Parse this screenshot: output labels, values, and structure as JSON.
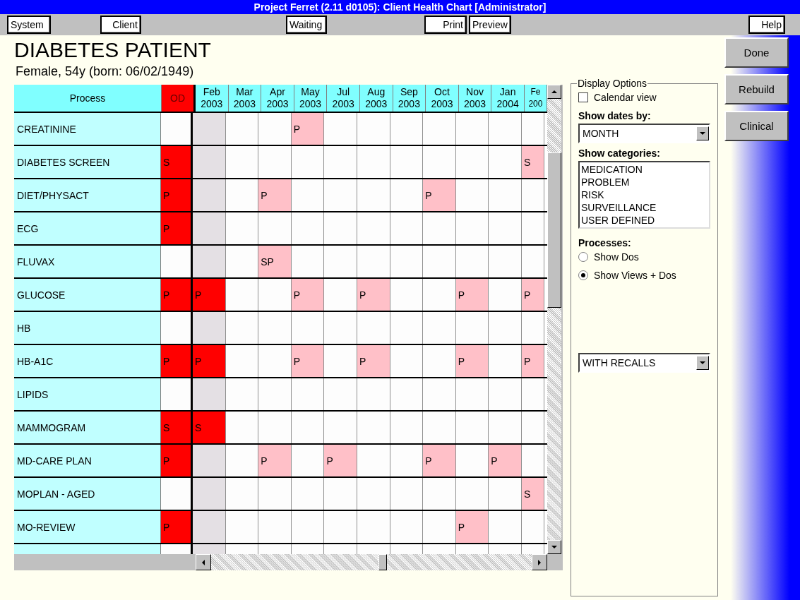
{
  "window": {
    "title": "Project Ferret (2.11 d0105): Client Health Chart [Administrator]"
  },
  "toolbar": [
    {
      "label": "System"
    },
    {
      "label": "Client"
    },
    {
      "label": "Waiting"
    },
    {
      "label": "Print"
    },
    {
      "label": "Preview"
    },
    {
      "label": "Help"
    }
  ],
  "patient": {
    "name": "DIABETES PATIENT",
    "details": "Female, 54y (born: 06/02/1949)"
  },
  "chart": {
    "process_heading": "Process",
    "od_heading": "OD",
    "months": [
      {
        "month": "Feb",
        "year": "2003"
      },
      {
        "month": "Mar",
        "year": "2003"
      },
      {
        "month": "Apr",
        "year": "2003"
      },
      {
        "month": "May",
        "year": "2003"
      },
      {
        "month": "Jul",
        "year": "2003"
      },
      {
        "month": "Aug",
        "year": "2003"
      },
      {
        "month": "Sep",
        "year": "2003"
      },
      {
        "month": "Oct",
        "year": "2003"
      },
      {
        "month": "Nov",
        "year": "2003"
      },
      {
        "month": "Jan",
        "year": "2004"
      },
      {
        "month": "Fe",
        "year": "200"
      }
    ],
    "rows": [
      {
        "name": "CREATININE",
        "od": {
          "kind": "empty"
        },
        "cells": [
          {
            "kind": "past"
          },
          {
            "kind": "empty"
          },
          {
            "kind": "empty"
          },
          {
            "kind": "pending",
            "mark": "P"
          },
          {
            "kind": "empty"
          },
          {
            "kind": "empty"
          },
          {
            "kind": "empty"
          },
          {
            "kind": "empty"
          },
          {
            "kind": "empty"
          },
          {
            "kind": "empty"
          },
          {
            "kind": "empty"
          }
        ]
      },
      {
        "name": "DIABETES SCREEN",
        "od": {
          "kind": "due",
          "mark": "S"
        },
        "cells": [
          {
            "kind": "past"
          },
          {
            "kind": "empty"
          },
          {
            "kind": "empty"
          },
          {
            "kind": "empty"
          },
          {
            "kind": "empty"
          },
          {
            "kind": "empty"
          },
          {
            "kind": "empty"
          },
          {
            "kind": "empty"
          },
          {
            "kind": "empty"
          },
          {
            "kind": "empty"
          },
          {
            "kind": "pending",
            "mark": "S"
          }
        ]
      },
      {
        "name": "DIET/PHYSACT",
        "od": {
          "kind": "due",
          "mark": "P"
        },
        "cells": [
          {
            "kind": "past"
          },
          {
            "kind": "empty"
          },
          {
            "kind": "pending",
            "mark": "P"
          },
          {
            "kind": "empty"
          },
          {
            "kind": "empty"
          },
          {
            "kind": "empty"
          },
          {
            "kind": "empty"
          },
          {
            "kind": "pending",
            "mark": "P"
          },
          {
            "kind": "empty"
          },
          {
            "kind": "empty"
          },
          {
            "kind": "empty"
          }
        ]
      },
      {
        "name": "ECG",
        "od": {
          "kind": "due",
          "mark": "P"
        },
        "cells": [
          {
            "kind": "past"
          },
          {
            "kind": "empty"
          },
          {
            "kind": "empty"
          },
          {
            "kind": "empty"
          },
          {
            "kind": "empty"
          },
          {
            "kind": "empty"
          },
          {
            "kind": "empty"
          },
          {
            "kind": "empty"
          },
          {
            "kind": "empty"
          },
          {
            "kind": "empty"
          },
          {
            "kind": "empty"
          }
        ]
      },
      {
        "name": "FLUVAX",
        "od": {
          "kind": "empty"
        },
        "cells": [
          {
            "kind": "past"
          },
          {
            "kind": "empty"
          },
          {
            "kind": "pending",
            "mark": "SP"
          },
          {
            "kind": "empty"
          },
          {
            "kind": "empty"
          },
          {
            "kind": "empty"
          },
          {
            "kind": "empty"
          },
          {
            "kind": "empty"
          },
          {
            "kind": "empty"
          },
          {
            "kind": "empty"
          },
          {
            "kind": "empty"
          }
        ]
      },
      {
        "name": "GLUCOSE",
        "od": {
          "kind": "due",
          "mark": "P"
        },
        "cells": [
          {
            "kind": "due",
            "mark": "P"
          },
          {
            "kind": "empty"
          },
          {
            "kind": "empty"
          },
          {
            "kind": "pending",
            "mark": "P"
          },
          {
            "kind": "empty"
          },
          {
            "kind": "pending",
            "mark": "P"
          },
          {
            "kind": "empty"
          },
          {
            "kind": "empty"
          },
          {
            "kind": "pending",
            "mark": "P"
          },
          {
            "kind": "empty"
          },
          {
            "kind": "pending",
            "mark": "P"
          }
        ]
      },
      {
        "name": "HB",
        "od": {
          "kind": "empty"
        },
        "cells": [
          {
            "kind": "past"
          },
          {
            "kind": "empty"
          },
          {
            "kind": "empty"
          },
          {
            "kind": "empty"
          },
          {
            "kind": "empty"
          },
          {
            "kind": "empty"
          },
          {
            "kind": "empty"
          },
          {
            "kind": "empty"
          },
          {
            "kind": "empty"
          },
          {
            "kind": "empty"
          },
          {
            "kind": "empty"
          }
        ]
      },
      {
        "name": "HB-A1C",
        "od": {
          "kind": "due",
          "mark": "P"
        },
        "cells": [
          {
            "kind": "due",
            "mark": "P"
          },
          {
            "kind": "empty"
          },
          {
            "kind": "empty"
          },
          {
            "kind": "pending",
            "mark": "P"
          },
          {
            "kind": "empty"
          },
          {
            "kind": "pending",
            "mark": "P"
          },
          {
            "kind": "empty"
          },
          {
            "kind": "empty"
          },
          {
            "kind": "pending",
            "mark": "P"
          },
          {
            "kind": "empty"
          },
          {
            "kind": "pending",
            "mark": "P"
          }
        ]
      },
      {
        "name": "LIPIDS",
        "od": {
          "kind": "empty"
        },
        "cells": [
          {
            "kind": "past"
          },
          {
            "kind": "empty"
          },
          {
            "kind": "empty"
          },
          {
            "kind": "empty"
          },
          {
            "kind": "empty"
          },
          {
            "kind": "empty"
          },
          {
            "kind": "empty"
          },
          {
            "kind": "empty"
          },
          {
            "kind": "empty"
          },
          {
            "kind": "empty"
          },
          {
            "kind": "empty"
          }
        ]
      },
      {
        "name": "MAMMOGRAM",
        "od": {
          "kind": "due",
          "mark": "S"
        },
        "cells": [
          {
            "kind": "due",
            "mark": "S"
          },
          {
            "kind": "empty"
          },
          {
            "kind": "empty"
          },
          {
            "kind": "empty"
          },
          {
            "kind": "empty"
          },
          {
            "kind": "empty"
          },
          {
            "kind": "empty"
          },
          {
            "kind": "empty"
          },
          {
            "kind": "empty"
          },
          {
            "kind": "empty"
          },
          {
            "kind": "empty"
          }
        ]
      },
      {
        "name": "MD-CARE PLAN",
        "od": {
          "kind": "due",
          "mark": "P"
        },
        "cells": [
          {
            "kind": "past"
          },
          {
            "kind": "empty"
          },
          {
            "kind": "pending",
            "mark": "P"
          },
          {
            "kind": "empty"
          },
          {
            "kind": "pending",
            "mark": "P"
          },
          {
            "kind": "empty"
          },
          {
            "kind": "empty"
          },
          {
            "kind": "pending",
            "mark": "P"
          },
          {
            "kind": "empty"
          },
          {
            "kind": "pending",
            "mark": "P"
          },
          {
            "kind": "empty"
          }
        ]
      },
      {
        "name": "MOPLAN - AGED",
        "od": {
          "kind": "empty"
        },
        "cells": [
          {
            "kind": "past"
          },
          {
            "kind": "empty"
          },
          {
            "kind": "empty"
          },
          {
            "kind": "empty"
          },
          {
            "kind": "empty"
          },
          {
            "kind": "empty"
          },
          {
            "kind": "empty"
          },
          {
            "kind": "empty"
          },
          {
            "kind": "empty"
          },
          {
            "kind": "empty"
          },
          {
            "kind": "pending",
            "mark": "S"
          }
        ]
      },
      {
        "name": "MO-REVIEW",
        "od": {
          "kind": "due",
          "mark": "P"
        },
        "cells": [
          {
            "kind": "past"
          },
          {
            "kind": "empty"
          },
          {
            "kind": "empty"
          },
          {
            "kind": "empty"
          },
          {
            "kind": "empty"
          },
          {
            "kind": "empty"
          },
          {
            "kind": "empty"
          },
          {
            "kind": "empty"
          },
          {
            "kind": "pending",
            "mark": "P"
          },
          {
            "kind": "empty"
          },
          {
            "kind": "empty"
          }
        ]
      },
      {
        "od": {
          "kind": "empty"
        },
        "cells": [
          {
            "kind": "past"
          },
          {
            "kind": "empty"
          },
          {
            "kind": "empty"
          },
          {
            "kind": "empty"
          },
          {
            "kind": "empty"
          },
          {
            "kind": "empty"
          },
          {
            "kind": "empty"
          },
          {
            "kind": "empty"
          },
          {
            "kind": "empty"
          },
          {
            "kind": "empty"
          },
          {
            "kind": "empty"
          }
        ]
      }
    ]
  },
  "display_options": {
    "title": "Display Options",
    "calendar_view": {
      "label": "Calendar view",
      "checked": false
    },
    "dates_label": "Show dates by:",
    "dates_value": "MONTH",
    "categories_label": "Show categories:",
    "categories": [
      {
        "label": "MEDICATION",
        "selected": false
      },
      {
        "label": "PROBLEM",
        "selected": false
      },
      {
        "label": "RISK",
        "selected": false
      },
      {
        "label": "SURVEILLANCE",
        "selected": false
      },
      {
        "label": "USER DEFINED",
        "selected": false
      }
    ],
    "processes_label": "Processes:",
    "processes": [
      {
        "label": "Show Dos",
        "selected": false
      },
      {
        "label": "Show Views + Dos",
        "selected": true
      }
    ],
    "recalls_value": "WITH RECALLS"
  },
  "side_buttons": [
    {
      "label": "Done"
    },
    {
      "label": "Rebuild"
    },
    {
      "label": "Clinical"
    }
  ]
}
